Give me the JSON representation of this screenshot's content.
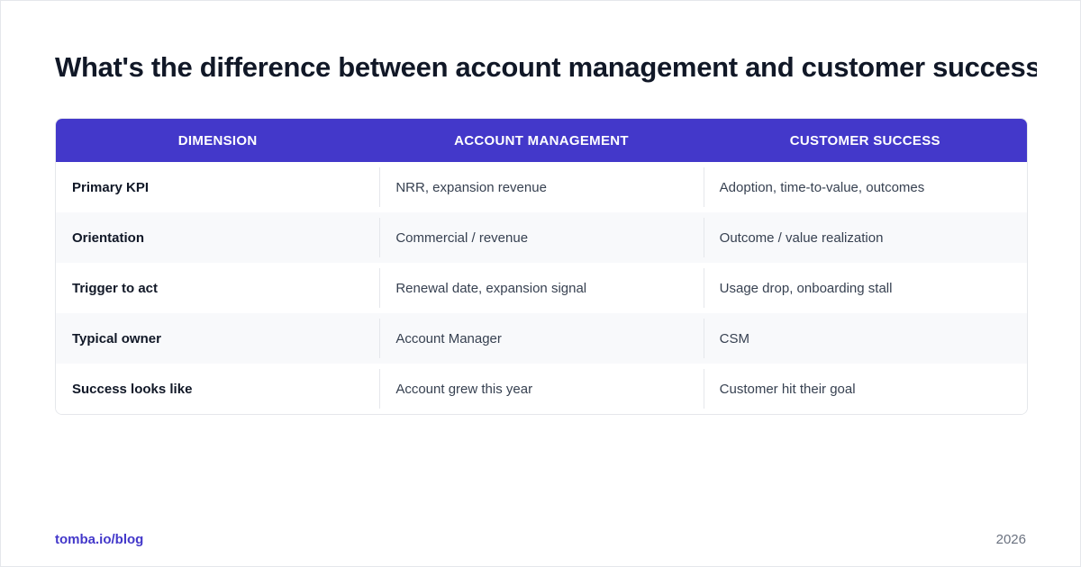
{
  "title": "What's the difference between account management and customer success…",
  "colors": {
    "header_bg": "#4338ca",
    "header_text": "#ffffff",
    "brand": "#4338ca",
    "row_alt_bg": "#f8f9fb"
  },
  "table": {
    "headers": [
      "DIMENSION",
      "ACCOUNT MANAGEMENT",
      "CUSTOMER SUCCESS"
    ],
    "rows": [
      [
        "Primary KPI",
        "NRR, expansion revenue",
        "Adoption, time-to-value, outcomes"
      ],
      [
        "Orientation",
        "Commercial / revenue",
        "Outcome / value realization"
      ],
      [
        "Trigger to act",
        "Renewal date, expansion signal",
        "Usage drop, onboarding stall"
      ],
      [
        "Typical owner",
        "Account Manager",
        "CSM"
      ],
      [
        "Success looks like",
        "Account grew this year",
        "Customer hit their goal"
      ]
    ]
  },
  "footer": {
    "brand": "tomba.io/blog",
    "year": "2026"
  }
}
